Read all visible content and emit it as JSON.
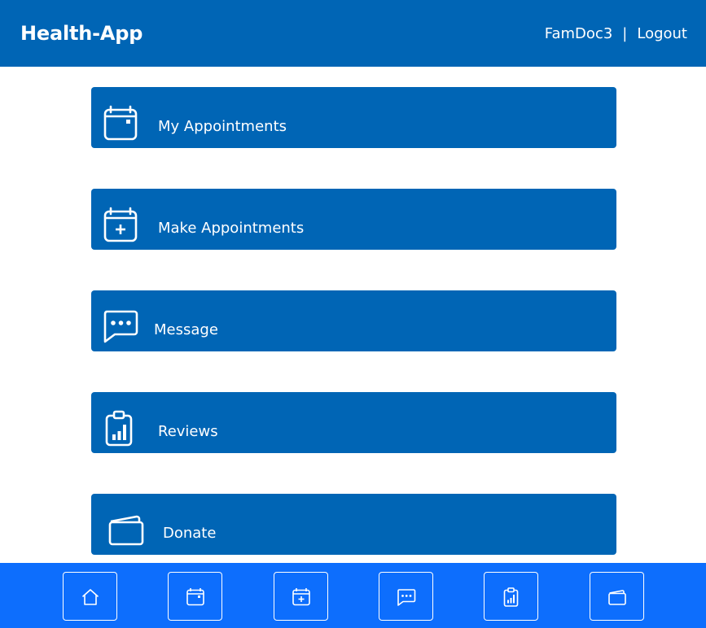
{
  "header": {
    "brand": "Health-App",
    "username": "FamDoc3",
    "separator": "|",
    "logout_label": "Logout",
    "background_color": "#0065B5"
  },
  "menu": [
    {
      "label": "My Appointments",
      "icon": "calendar-icon"
    },
    {
      "label": "Make Appointments",
      "icon": "calendar-plus-icon"
    },
    {
      "label": "Message",
      "icon": "chat-dots-icon"
    },
    {
      "label": "Reviews",
      "icon": "clipboard-data-icon"
    },
    {
      "label": "Donate",
      "icon": "wallet-icon"
    }
  ],
  "footer": {
    "background_color": "#0D6EFD",
    "buttons": [
      {
        "icon": "house-icon"
      },
      {
        "icon": "calendar-icon"
      },
      {
        "icon": "calendar-plus-icon"
      },
      {
        "icon": "chat-dots-icon"
      },
      {
        "icon": "clipboard-data-icon"
      },
      {
        "icon": "wallet-icon"
      }
    ]
  }
}
